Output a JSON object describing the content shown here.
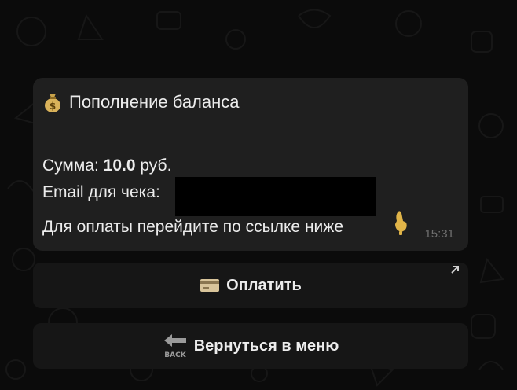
{
  "message": {
    "title": "Пополнение баланса",
    "amount_label": "Сумма: ",
    "amount_value": "10.0",
    "amount_unit": " руб.",
    "email_label": "Email для чека:",
    "instruction": "Для оплаты перейдите по ссылке ниже",
    "time": "15:31"
  },
  "buttons": {
    "pay_label": "Оплатить",
    "back_label": "Вернуться в меню",
    "back_icon_text": "BACK"
  },
  "colors": {
    "background": "#0b0b0b",
    "bubble": "#1f1f1f",
    "button": "#161616",
    "arrow": "#b0101f",
    "text": "#ececec"
  }
}
